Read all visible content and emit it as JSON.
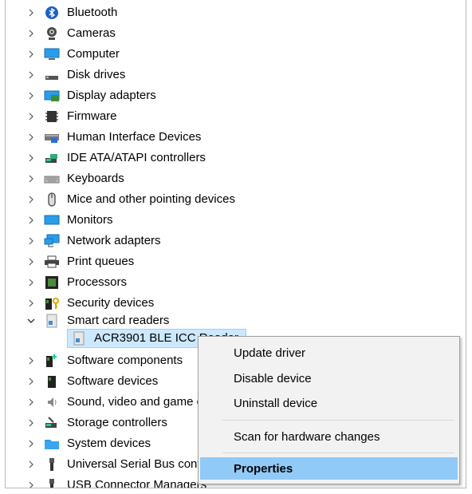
{
  "tree": {
    "items": [
      {
        "label": "Bluetooth",
        "icon": "bluetooth-icon",
        "expanded": false
      },
      {
        "label": "Cameras",
        "icon": "camera-icon",
        "expanded": false
      },
      {
        "label": "Computer",
        "icon": "computer-icon",
        "expanded": false
      },
      {
        "label": "Disk drives",
        "icon": "disk-drive-icon",
        "expanded": false
      },
      {
        "label": "Display adapters",
        "icon": "display-adapter-icon",
        "expanded": false
      },
      {
        "label": "Firmware",
        "icon": "firmware-icon",
        "expanded": false
      },
      {
        "label": "Human Interface Devices",
        "icon": "hid-icon",
        "expanded": false
      },
      {
        "label": "IDE ATA/ATAPI controllers",
        "icon": "ide-controller-icon",
        "expanded": false
      },
      {
        "label": "Keyboards",
        "icon": "keyboard-icon",
        "expanded": false
      },
      {
        "label": "Mice and other pointing devices",
        "icon": "mouse-icon",
        "expanded": false
      },
      {
        "label": "Monitors",
        "icon": "monitor-icon",
        "expanded": false
      },
      {
        "label": "Network adapters",
        "icon": "network-adapter-icon",
        "expanded": false
      },
      {
        "label": "Print queues",
        "icon": "printer-icon",
        "expanded": false
      },
      {
        "label": "Processors",
        "icon": "processor-icon",
        "expanded": false
      },
      {
        "label": "Security devices",
        "icon": "security-device-icon",
        "expanded": false
      },
      {
        "label": "Smart card readers",
        "icon": "smart-card-reader-icon",
        "expanded": true
      },
      {
        "label": "ACR3901 BLE ICC Reader",
        "icon": "smart-card-reader-icon",
        "child": true,
        "selected": true
      },
      {
        "label": "Software components",
        "icon": "software-component-icon",
        "expanded": false
      },
      {
        "label": "Software devices",
        "icon": "software-device-icon",
        "expanded": false
      },
      {
        "label": "Sound, video and game controllers",
        "icon": "speaker-icon",
        "expanded": false
      },
      {
        "label": "Storage controllers",
        "icon": "storage-controller-icon",
        "expanded": false
      },
      {
        "label": "System devices",
        "icon": "system-devices-icon",
        "expanded": false
      },
      {
        "label": "Universal Serial Bus controllers",
        "icon": "usb-icon",
        "expanded": false
      },
      {
        "label": "USB Connector Managers",
        "icon": "usb-icon",
        "expanded": false
      }
    ]
  },
  "context_menu": {
    "update_driver": "Update driver",
    "disable_device": "Disable device",
    "uninstall_device": "Uninstall device",
    "scan_hardware": "Scan for hardware changes",
    "properties": "Properties"
  },
  "colors": {
    "selection_bg": "#cce8ff",
    "menu_highlight": "#91c9f7",
    "menu_bg": "#f2f2f2"
  }
}
